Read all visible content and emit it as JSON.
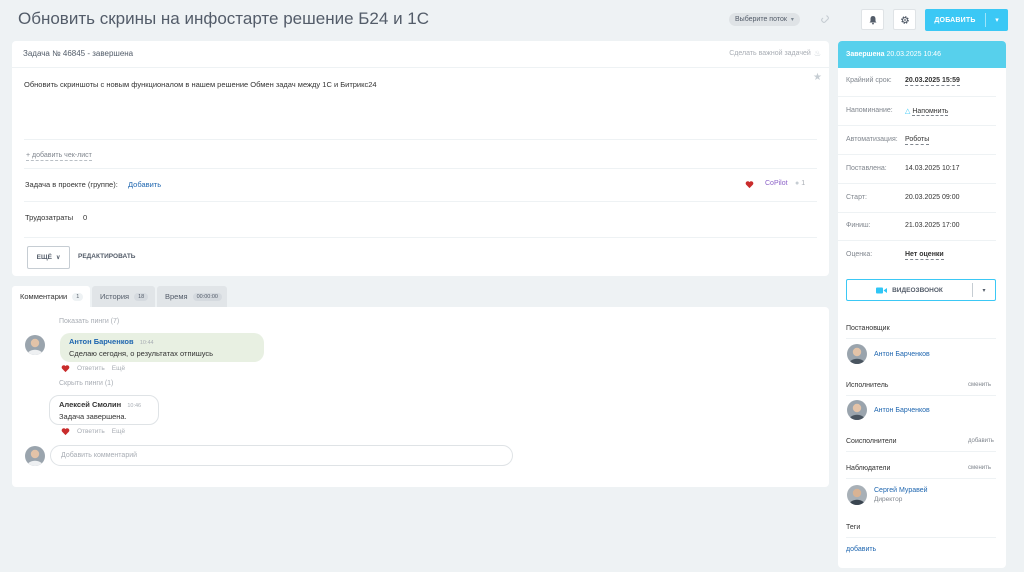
{
  "header": {
    "title": "Обновить скрины на инфостарте решение Б24 и 1С",
    "flow_select": "Выберите поток",
    "add_button": "ДОБАВИТЬ",
    "icons": [
      "bell-icon",
      "gear-icon",
      "link-icon"
    ]
  },
  "task": {
    "number_status": "Задача № 46845 - завершена",
    "important_link": "Сделать важной задачей",
    "description": "Обновить скриншоты с новым функционалом в нашем решение Обмен задач между 1С и Битрикс24",
    "add_checklist": "+ добавить чек-лист",
    "project_label": "Задача в проекте (группе):",
    "project_add": "Добавить",
    "copilot": "CoPilot",
    "copilot_count": "1",
    "labor_label": "Трудозатраты",
    "labor_value": "0",
    "more_button": "ЕЩЁ",
    "edit_button": "РЕДАКТИРОВАТЬ"
  },
  "tabs": [
    {
      "label": "Комментарии",
      "count": "1"
    },
    {
      "label": "История",
      "count": "18"
    },
    {
      "label": "Время",
      "count": "00:00:00"
    }
  ],
  "comments": {
    "show_pings": "Показать пинги (7)",
    "hide_pings": "Скрыть пинги (1)",
    "items": [
      {
        "author": "Антон Барченков",
        "time": "10:44",
        "text": "Сделаю сегодня, о результатах отпишусь",
        "reply": "Ответить",
        "more": "Ещё"
      },
      {
        "author": "Алексей Смолин",
        "time": "10:46",
        "text": "Задача завершена.",
        "reply": "Ответить",
        "more": "Ещё"
      }
    ],
    "placeholder": "Добавить комментарий"
  },
  "sidebar": {
    "status_label": "Завершена",
    "status_date": "20.03.2025 10:46",
    "rows": [
      {
        "label": "Крайний срок:",
        "value": "20.03.2025 15:59"
      },
      {
        "label": "Напоминание:",
        "value": "Напомнить"
      },
      {
        "label": "Автоматизация:",
        "value": "Роботы"
      },
      {
        "label": "Поставлена:",
        "value": "14.03.2025 10:17"
      },
      {
        "label": "Старт:",
        "value": "20.03.2025 09:00"
      },
      {
        "label": "Финиш:",
        "value": "21.03.2025 17:00"
      },
      {
        "label": "Оценка:",
        "value": "Нет оценки"
      }
    ],
    "video_button": "ВИДЕОЗВОНОК",
    "creator_title": "Постановщик",
    "creator": "Антон Барченков",
    "assignee_title": "Исполнитель",
    "assignee_action": "сменить",
    "assignee": "Антон Барченков",
    "coexecutors_title": "Соисполнители",
    "coexecutors_action": "добавить",
    "observers_title": "Наблюдатели",
    "observers_action": "сменить",
    "observer": "Сергей Муравей",
    "observer_role": "Директор",
    "tags_title": "Теги",
    "tags_add": "добавить"
  },
  "colors": {
    "accent": "#3bc8f5",
    "status_header": "#57d0ec",
    "link": "#2067b0",
    "like": "#c92c2c",
    "comment_bubble": "#e8f0e2"
  }
}
